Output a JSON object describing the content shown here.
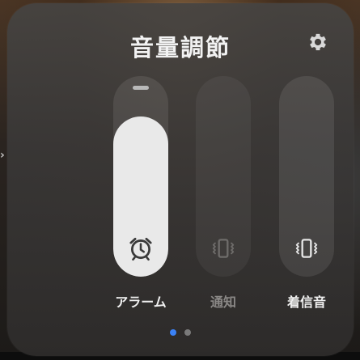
{
  "panel": {
    "title": "音量調節",
    "settings_icon": "gear-icon"
  },
  "sliders": [
    {
      "id": "alarm",
      "label": "アラーム",
      "level": 0.8,
      "active": true,
      "icon": "alarm-clock-icon"
    },
    {
      "id": "notify",
      "label": "通知",
      "level": 0.0,
      "active": false,
      "icon": "vibrate-icon"
    },
    {
      "id": "ringtone",
      "label": "着信音",
      "level": 0.0,
      "active": true,
      "icon": "vibrate-icon"
    }
  ],
  "pagination": {
    "page_count": 2,
    "current_page": 1,
    "active_color": "#3b82f6",
    "inactive_color": "#7a7a7a"
  },
  "colors": {
    "panel_bg": "#3e3c3b",
    "slider_fill": "#e9e9e9"
  }
}
